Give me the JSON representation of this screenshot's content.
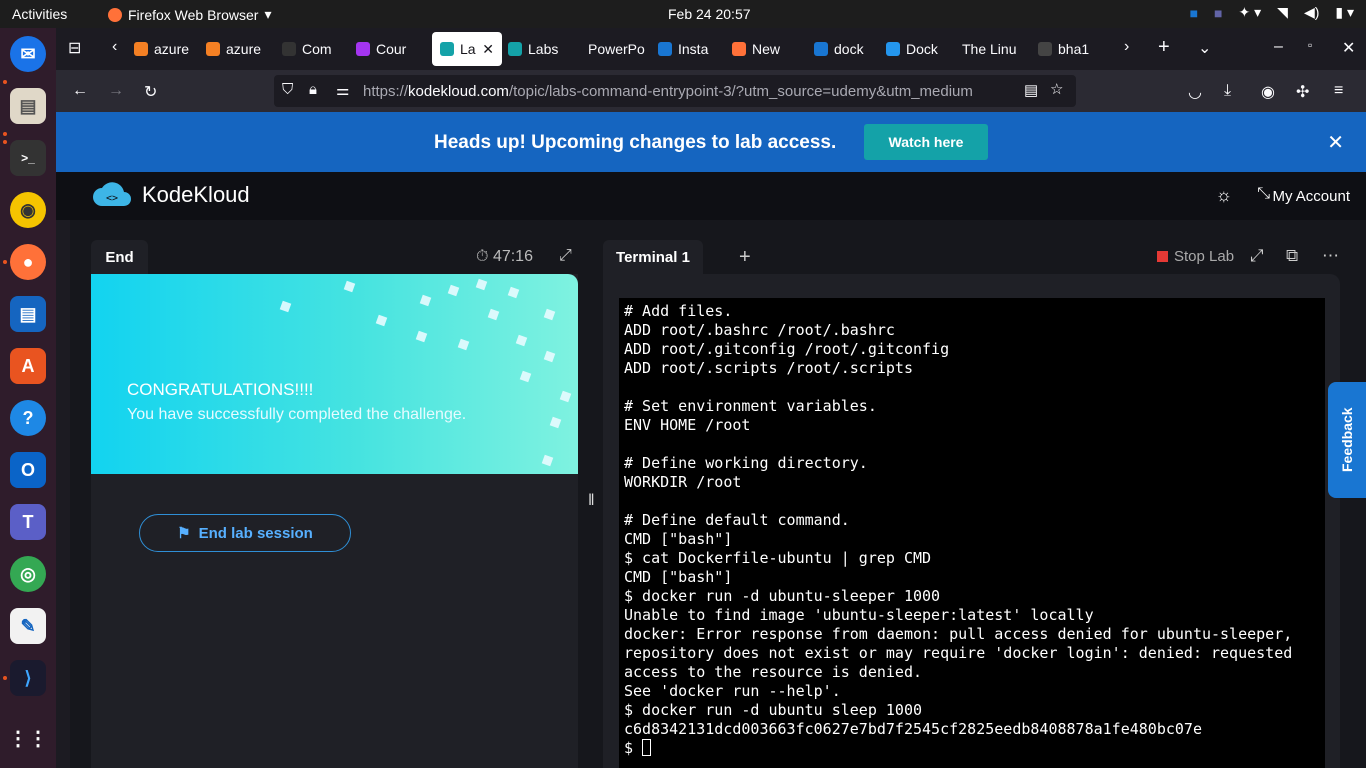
{
  "topbar": {
    "activities": "Activities",
    "app": "Firefox Web Browser",
    "clock": "Feb 24  20:57"
  },
  "tabs": [
    {
      "label": "azure",
      "color": "#f48024"
    },
    {
      "label": "azure",
      "color": "#f48024"
    },
    {
      "label": "Com",
      "color": "#333333"
    },
    {
      "label": "Cour",
      "color": "#a435f0"
    },
    {
      "label": "La",
      "color": "#14a2a8"
    },
    {
      "label": "Labs",
      "color": "#14a2a8"
    },
    {
      "label": "PowerPo",
      "color": ""
    },
    {
      "label": "Insta",
      "color": "#1976d2"
    },
    {
      "label": "New",
      "color": "#ff7139"
    },
    {
      "label": "dock",
      "color": "#1976d2"
    },
    {
      "label": "Dock",
      "color": "#2496ed"
    },
    {
      "label": "The Linu",
      "color": ""
    },
    {
      "label": "bha1",
      "color": "#444444"
    }
  ],
  "url": {
    "prefix": "https://",
    "host": "kodekloud.com",
    "path": "/topic/labs-command-entrypoint-3/?utm_source=udemy&utm_medium"
  },
  "banner": {
    "message": "Heads up! Upcoming changes to lab access.",
    "button": "Watch here",
    "close": "✕"
  },
  "header": {
    "brand": "KodeKloud",
    "account": "My Account"
  },
  "left": {
    "tab": "End",
    "timer": "47:16",
    "congrats": "CONGRATULATIONS!!!!",
    "subtitle": "You have successfully completed the challenge.",
    "end_button": "End lab session"
  },
  "right": {
    "tab": "Terminal 1",
    "stop": "Stop Lab"
  },
  "terminal": {
    "lines": [
      "# Add files.",
      "ADD root/.bashrc /root/.bashrc",
      "ADD root/.gitconfig /root/.gitconfig",
      "ADD root/.scripts /root/.scripts",
      "",
      "# Set environment variables.",
      "ENV HOME /root",
      "",
      "# Define working directory.",
      "WORKDIR /root",
      "",
      "# Define default command.",
      "CMD [\"bash\"]",
      "$ cat Dockerfile-ubuntu | grep CMD",
      "CMD [\"bash\"]",
      "$ docker run -d ubuntu-sleeper 1000",
      "Unable to find image 'ubuntu-sleeper:latest' locally",
      "docker: Error response from daemon: pull access denied for ubuntu-sleeper,",
      "repository does not exist or may require 'docker login': denied: requested",
      "access to the resource is denied.",
      "See 'docker run --help'.",
      "$ docker run -d ubuntu sleep 1000",
      "c6d8342131dcd003663fc0627e7bd7f2545cf2825eedb8408878a1fe480bc07e"
    ],
    "prompt": "$ "
  },
  "feedback": "Feedback"
}
